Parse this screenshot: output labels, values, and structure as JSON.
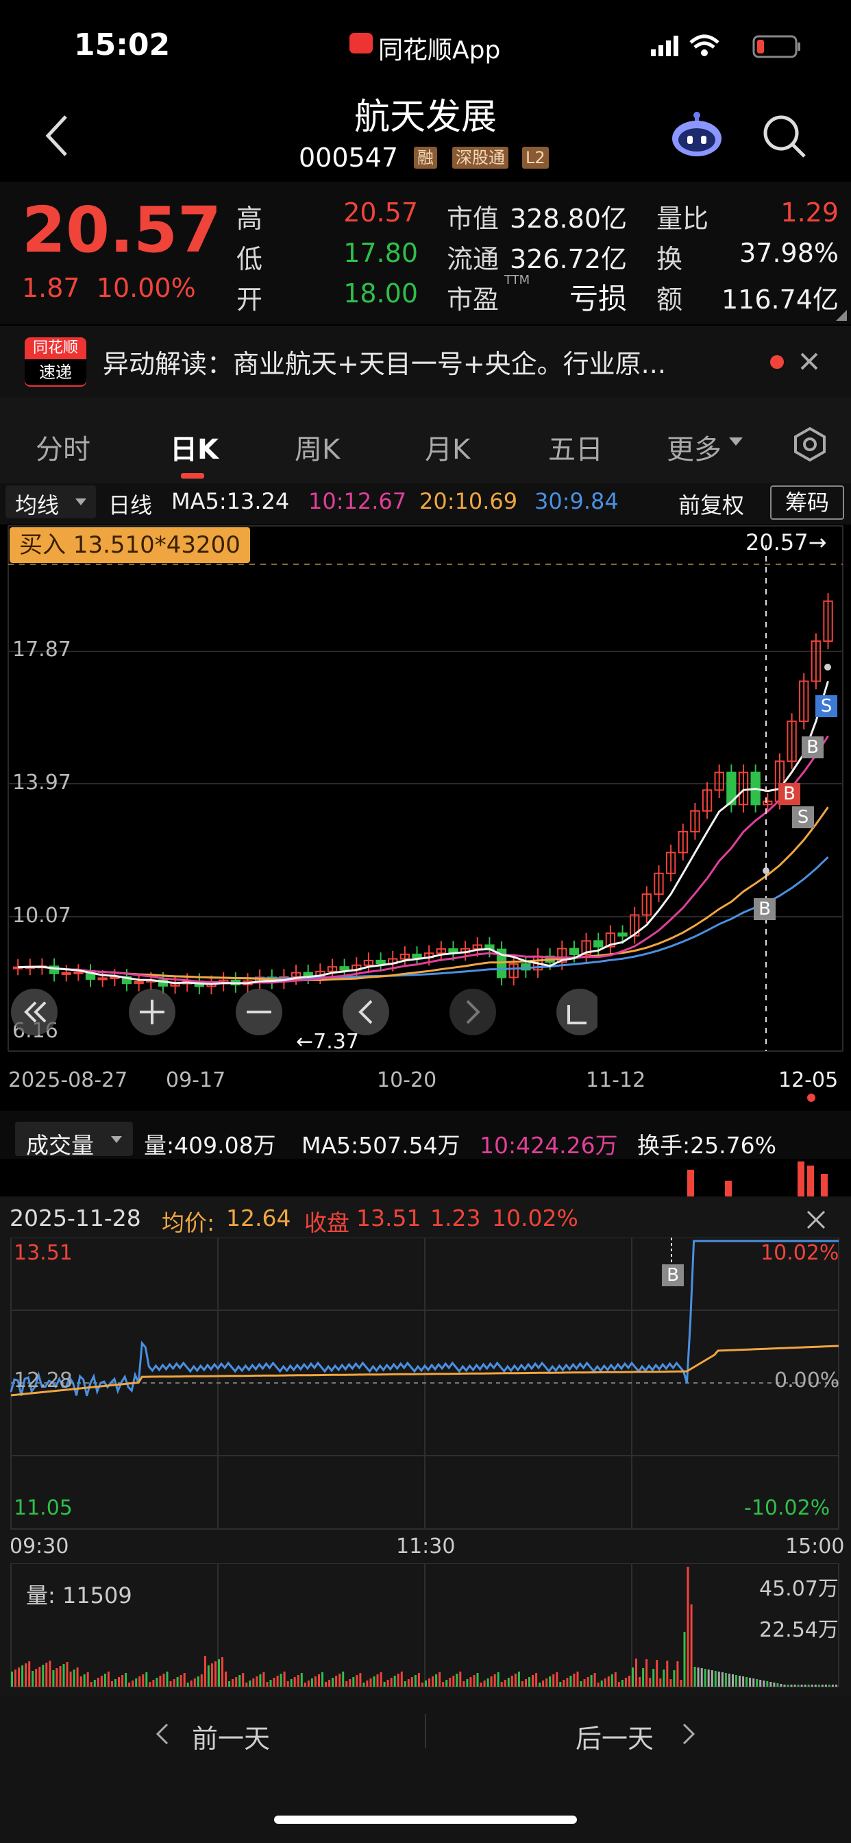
{
  "status_bar": {
    "time": "15:02",
    "app": "同花顺App"
  },
  "header": {
    "title": "航天发展",
    "code": "000547",
    "tags": [
      "融",
      "深股通",
      "L2"
    ]
  },
  "quote": {
    "price": "20.57",
    "change": "1.87",
    "change_pct": "10.00%",
    "high_label": "高",
    "high": "20.57",
    "low_label": "低",
    "low": "17.80",
    "open_label": "开",
    "open": "18.00",
    "mcap_label": "市值",
    "mcap": "328.80亿",
    "float_label": "流通",
    "float": "326.72亿",
    "pe_label": "市盈",
    "pe_sup": "TTM",
    "pe": "亏损",
    "vr_label": "量比",
    "vr": "1.29",
    "turn_label": "换",
    "turn": "37.98%",
    "amt_label": "额",
    "amt": "116.74亿"
  },
  "news": {
    "logo_top": "同花顺",
    "logo_bottom": "速递",
    "text": "异动解读：商业航天+天目一号+央企。行业原..."
  },
  "tabs": [
    "分时",
    "日K",
    "周K",
    "月K",
    "五日",
    "更多"
  ],
  "active_tab": "日K",
  "ma_bar": {
    "select": "均线",
    "period": "日线",
    "ma5": "MA5:13.24",
    "ma10": "10:12.67",
    "ma20": "20:10.69",
    "ma30": "30:9.84",
    "adjust": "前复权",
    "chips": "筹码"
  },
  "chart_data": {
    "type": "candlestick",
    "trade_badge": "买入 13.510*43200",
    "high_marker": "20.57→",
    "low_marker": "←7.37",
    "y_ticks": [
      "17.87",
      "13.97",
      "10.07",
      "6.16"
    ],
    "x_ticks": [
      "2025-08-27",
      "09-17",
      "10-20",
      "11-12",
      "12-05"
    ],
    "markers": [
      "S",
      "B",
      "B",
      "S",
      "B"
    ],
    "colors": {
      "up": "#f0443a",
      "down": "#2fbf4a",
      "ma5": "#f2f2f2",
      "ma10": "#e0409a",
      "ma20": "#f0a640",
      "ma30": "#4a90e2"
    }
  },
  "volume_bar": {
    "select": "成交量",
    "vol": "量:409.08万",
    "ma5": "MA5:507.54万",
    "ma10": "10:424.26万",
    "turnover": "换手:25.76%"
  },
  "intraday": {
    "date": "2025-11-28",
    "avg_label": "均价:",
    "avg": "12.64",
    "close_label": "收盘",
    "close": "13.51",
    "chg": "1.23",
    "pct": "10.02%",
    "y_top": "13.51",
    "y_mid": "12.28",
    "y_bot": "11.05",
    "pct_top": "10.02%",
    "pct_mid": "0.00%",
    "pct_bot": "-10.02%",
    "x_ticks": [
      "09:30",
      "11:30",
      "15:00"
    ],
    "vol_label": "量: 11509",
    "vol_top": "45.07万",
    "vol_mid": "22.54万",
    "marker": "B"
  },
  "nav": {
    "prev": "前一天",
    "next": "后一天"
  }
}
